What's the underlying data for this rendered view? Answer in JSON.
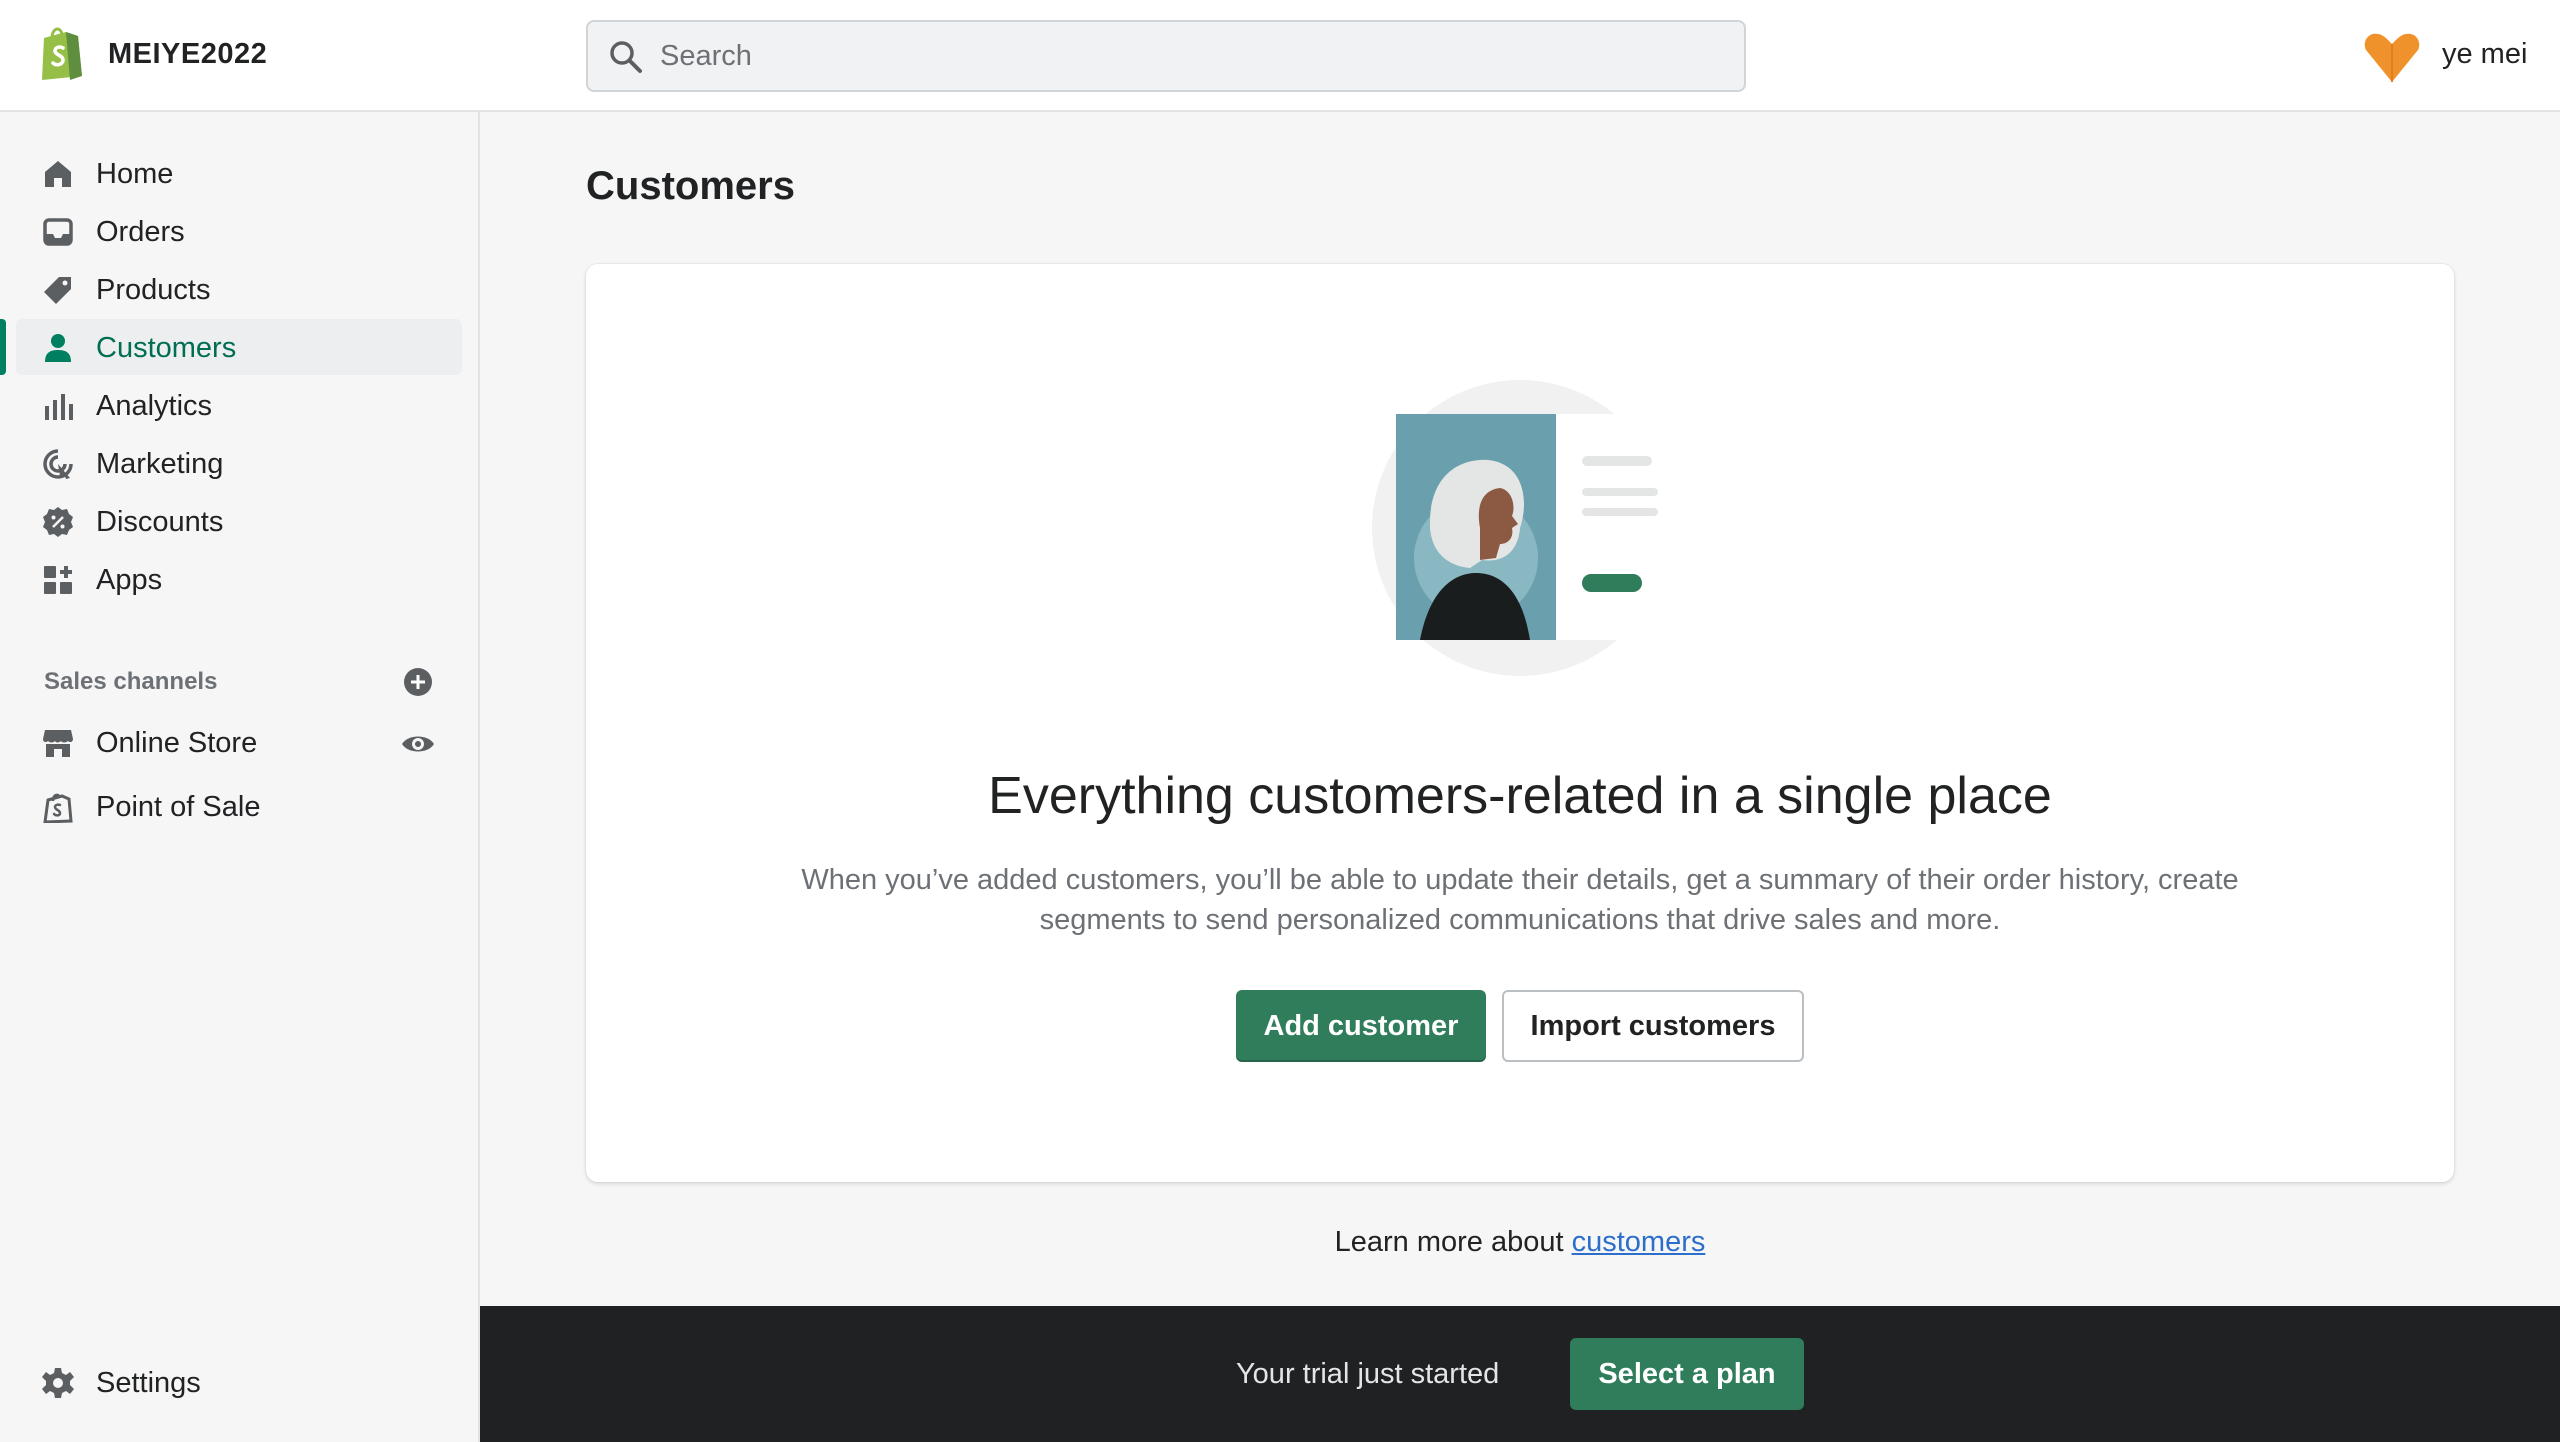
{
  "header": {
    "store_name": "MEIYE2022",
    "search_placeholder": "Search",
    "user_name": "ye mei"
  },
  "sidebar": {
    "items": [
      {
        "label": "Home",
        "icon": "home-icon"
      },
      {
        "label": "Orders",
        "icon": "inbox-icon"
      },
      {
        "label": "Products",
        "icon": "tag-icon"
      },
      {
        "label": "Customers",
        "icon": "person-icon",
        "active": true
      },
      {
        "label": "Analytics",
        "icon": "bar-chart-icon"
      },
      {
        "label": "Marketing",
        "icon": "target-icon"
      },
      {
        "label": "Discounts",
        "icon": "discount-icon"
      },
      {
        "label": "Apps",
        "icon": "apps-icon"
      }
    ],
    "sales_channels_title": "Sales channels",
    "channels": [
      {
        "label": "Online Store",
        "icon": "store-icon"
      },
      {
        "label": "Point of Sale",
        "icon": "pos-bag-icon"
      }
    ],
    "settings_label": "Settings"
  },
  "main": {
    "title": "Customers",
    "empty_state": {
      "heading": "Everything customers-related in a single place",
      "body": "When you’ve added customers, you’ll be able to update their details, get a summary of their order history, create segments to send personalized communications that drive sales and more.",
      "primary_action": "Add customer",
      "secondary_action": "Import customers"
    },
    "learn_more_prefix": "Learn more about ",
    "learn_more_link": "customers"
  },
  "trial_bar": {
    "text": "Your trial just started",
    "button": "Select a plan"
  },
  "colors": {
    "brand_green": "#2f7d5b",
    "active_text": "#006e52",
    "link": "#2c6ecb",
    "trial_bg": "#202123",
    "avatar": "#f0922c"
  }
}
